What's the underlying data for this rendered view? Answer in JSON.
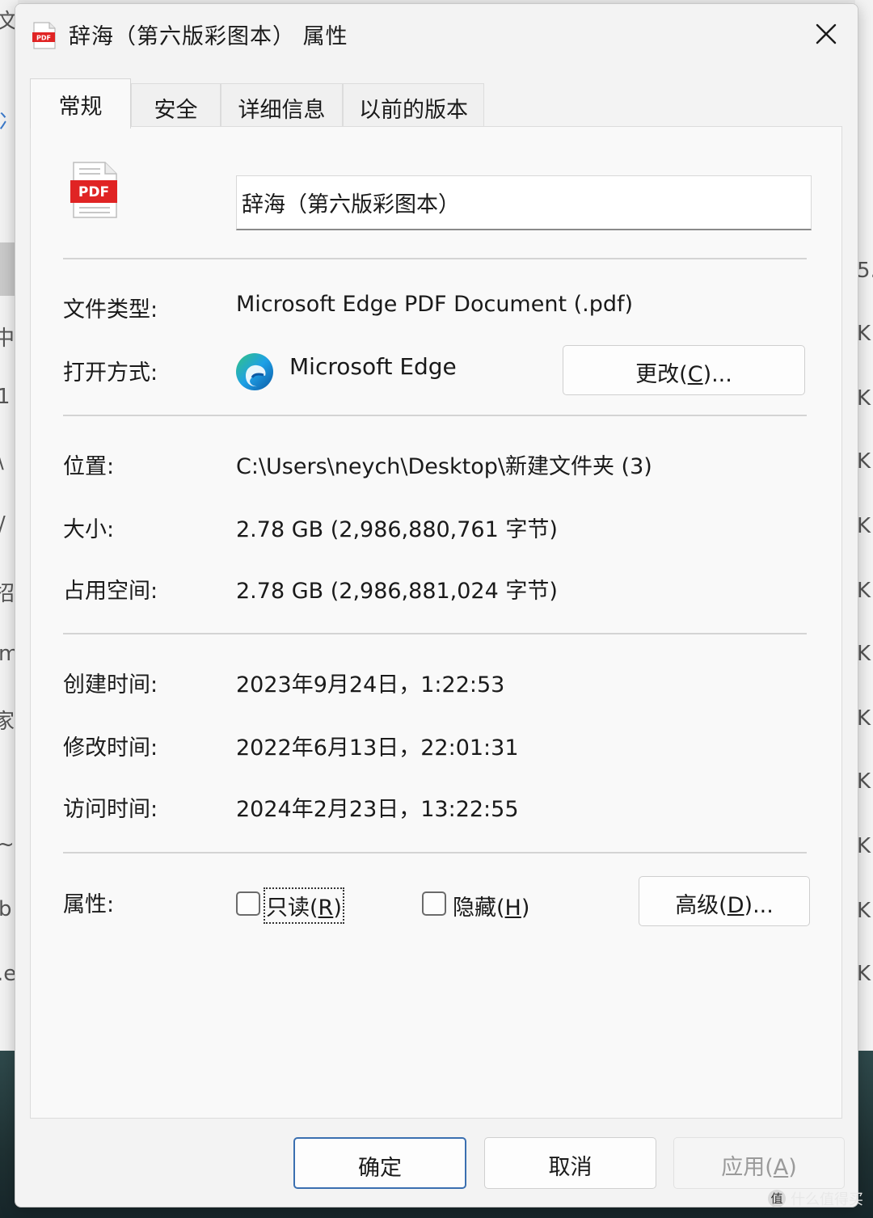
{
  "window": {
    "title": "辞海（第六版彩图本） 属性",
    "close_glyph": "✕"
  },
  "tabs": [
    {
      "label": "常规",
      "active": true
    },
    {
      "label": "安全",
      "active": false
    },
    {
      "label": "详细信息",
      "active": false
    },
    {
      "label": "以前的版本",
      "active": false
    }
  ],
  "file": {
    "icon_text": "PDF",
    "name": "辞海（第六版彩图本）"
  },
  "type_row": {
    "label": "文件类型:",
    "value": "Microsoft Edge PDF Document (.pdf)"
  },
  "open_row": {
    "label": "打开方式:",
    "app": "Microsoft Edge",
    "change_prefix": "更改(",
    "change_key": "C",
    "change_suffix": ")..."
  },
  "location_row": {
    "label": "位置:",
    "value": "C:\\Users\\neych\\Desktop\\新建文件夹 (3)"
  },
  "size_row": {
    "label": "大小:",
    "value": "2.78 GB (2,986,880,761 字节)"
  },
  "disk_row": {
    "label": "占用空间:",
    "value": "2.78 GB (2,986,881,024 字节)"
  },
  "created_row": {
    "label": "创建时间:",
    "value": "2023年9月24日，1:22:53"
  },
  "modified_row": {
    "label": "修改时间:",
    "value": "2022年6月13日，22:01:31"
  },
  "accessed_row": {
    "label": "访问时间:",
    "value": "2024年2月23日，13:22:55"
  },
  "attributes": {
    "label": "属性:",
    "readonly": {
      "prefix": "只读(",
      "key": "R",
      "suffix": ")",
      "checked": false
    },
    "hidden": {
      "prefix": "隐藏(",
      "key": "H",
      "suffix": ")",
      "checked": false
    },
    "advanced": {
      "prefix": "高级(",
      "key": "D",
      "suffix": ")..."
    }
  },
  "footer": {
    "ok": "确定",
    "cancel": "取消",
    "apply_prefix": "应用(",
    "apply_key": "A",
    "apply_suffix": ")"
  },
  "watermark": {
    "badge": "值",
    "text": "什么值得买"
  },
  "background": {
    "left_glyphs": [
      "文件",
      "冫",
      "中",
      "1",
      "\\",
      "/ :",
      "招",
      "m",
      "家",
      "~",
      "b",
      ".e"
    ],
    "right_glyphs": [
      "5.",
      "K",
      "K",
      "K",
      "K",
      "K",
      "K",
      "K",
      "K",
      "K",
      "K",
      "K"
    ]
  },
  "colors": {
    "pdf_red": "#e02424",
    "ok_border": "#3a6fb0",
    "dialog_bg": "#f3f3f3"
  }
}
